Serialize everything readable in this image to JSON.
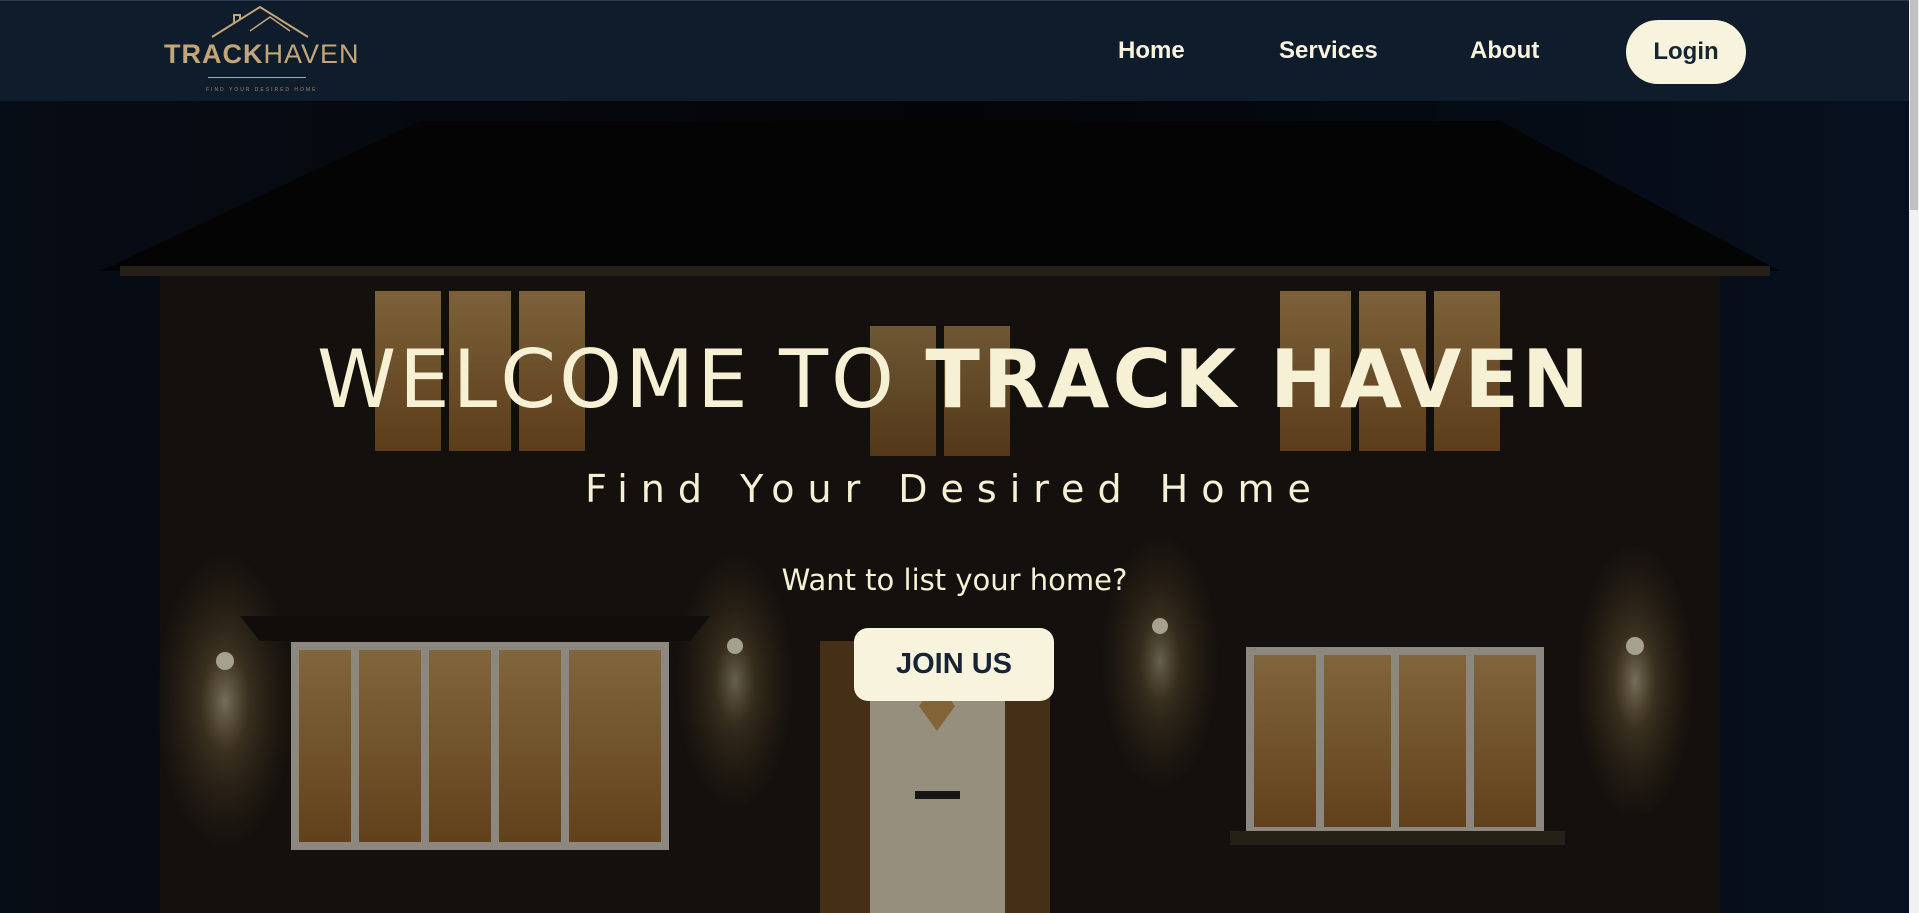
{
  "logo": {
    "word_bold": "TRACK",
    "word_light": "HAVEN",
    "tagline": "FIND YOUR DESIRED HOME"
  },
  "nav": {
    "home": "Home",
    "services": "Services",
    "about": "About",
    "login": "Login"
  },
  "hero": {
    "title_light": "WELCOME TO",
    "title_bold": "TRACK HAVEN",
    "subtitle": "Find Your Desired Home",
    "question": "Want to list your home?",
    "cta": "JOIN US"
  },
  "colors": {
    "nav_bg": "#0f1c2c",
    "cream": "#f7f3dc",
    "gold": "#c2a67a",
    "dark_text": "#172435"
  }
}
